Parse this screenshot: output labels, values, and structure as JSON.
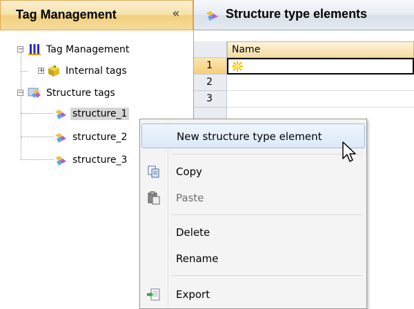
{
  "left_panel": {
    "title": "Tag Management",
    "collapse_glyph": "«",
    "tree": {
      "root": {
        "label": "Tag Management",
        "icon": "tag-management-icon",
        "expander": "−"
      },
      "internal": {
        "label": "Internal tags",
        "icon": "internal-tags-icon",
        "expander": "+"
      },
      "structure": {
        "label": "Structure tags",
        "icon": "structure-tags-icon",
        "expander": "−"
      },
      "items": [
        {
          "label": "structure_1",
          "selected": true
        },
        {
          "label": "structure_2",
          "selected": false
        },
        {
          "label": "structure_3",
          "selected": false
        }
      ]
    }
  },
  "right_panel": {
    "title": "Structure type elements",
    "column_name": "Name",
    "rows": [
      "1",
      "2",
      "3"
    ]
  },
  "context_menu": {
    "new_element": "New structure type element",
    "copy": "Copy",
    "paste": "Paste",
    "delete": "Delete",
    "rename": "Rename",
    "export": "Export"
  },
  "colors": {
    "header_orange": "#f1cf7c",
    "menu_highlight": "#dce9f8",
    "selection_gray": "#d6d6d6"
  }
}
